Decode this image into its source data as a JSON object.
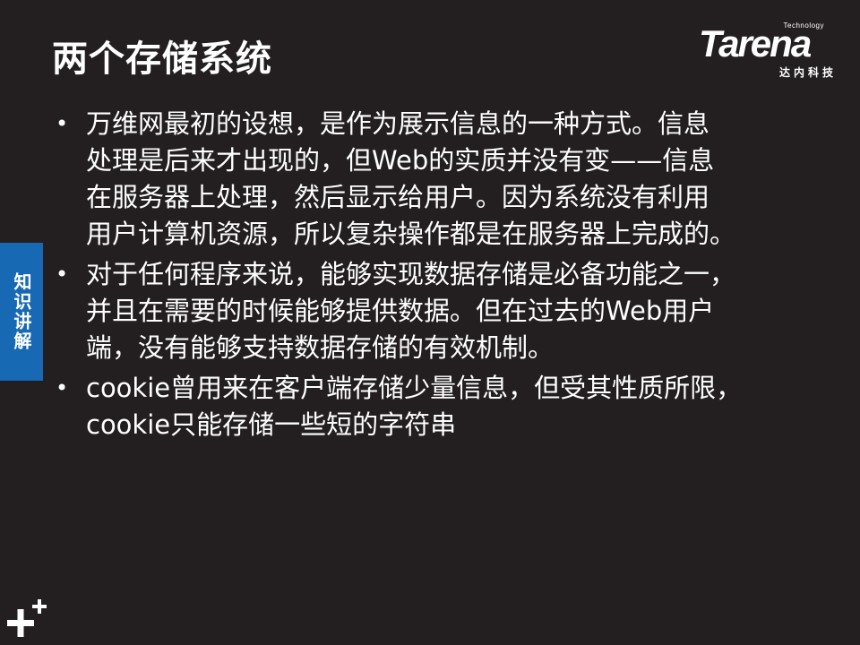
{
  "slide": {
    "title": "两个存储系统",
    "side_tab_label": "知识讲解",
    "logo": {
      "wordmark": "Tarena",
      "tagline": "Technology",
      "chinese": "达内科技"
    },
    "bullets": [
      {
        "lines": [
          "万维网最初的设想，是作为展示信息的一种方式。信息",
          "处理是后来才出现的，但Web的实质并没有变——信息",
          "在服务器上处理，然后显示给用户。因为系统没有利用",
          "用户计算机资源，所以复杂操作都是在服务器上完成的。"
        ]
      },
      {
        "lines": [
          "对于任何程序来说，能够实现数据存储是必备功能之一，",
          "并且在需要的时候能够提供数据。但在过去的Web用户",
          "端，没有能够支持数据存储的有效机制。"
        ]
      },
      {
        "lines": [
          "cookie曾用来在客户端存储少量信息，但受其性质所限，",
          "cookie只能存储一些短的字符串"
        ]
      }
    ],
    "bullet_glyph": "•"
  },
  "colors": {
    "background": "#231f20",
    "text": "#ffffff",
    "side_tab": "#1769b4"
  },
  "icons": {
    "corner": "plus-icon"
  }
}
